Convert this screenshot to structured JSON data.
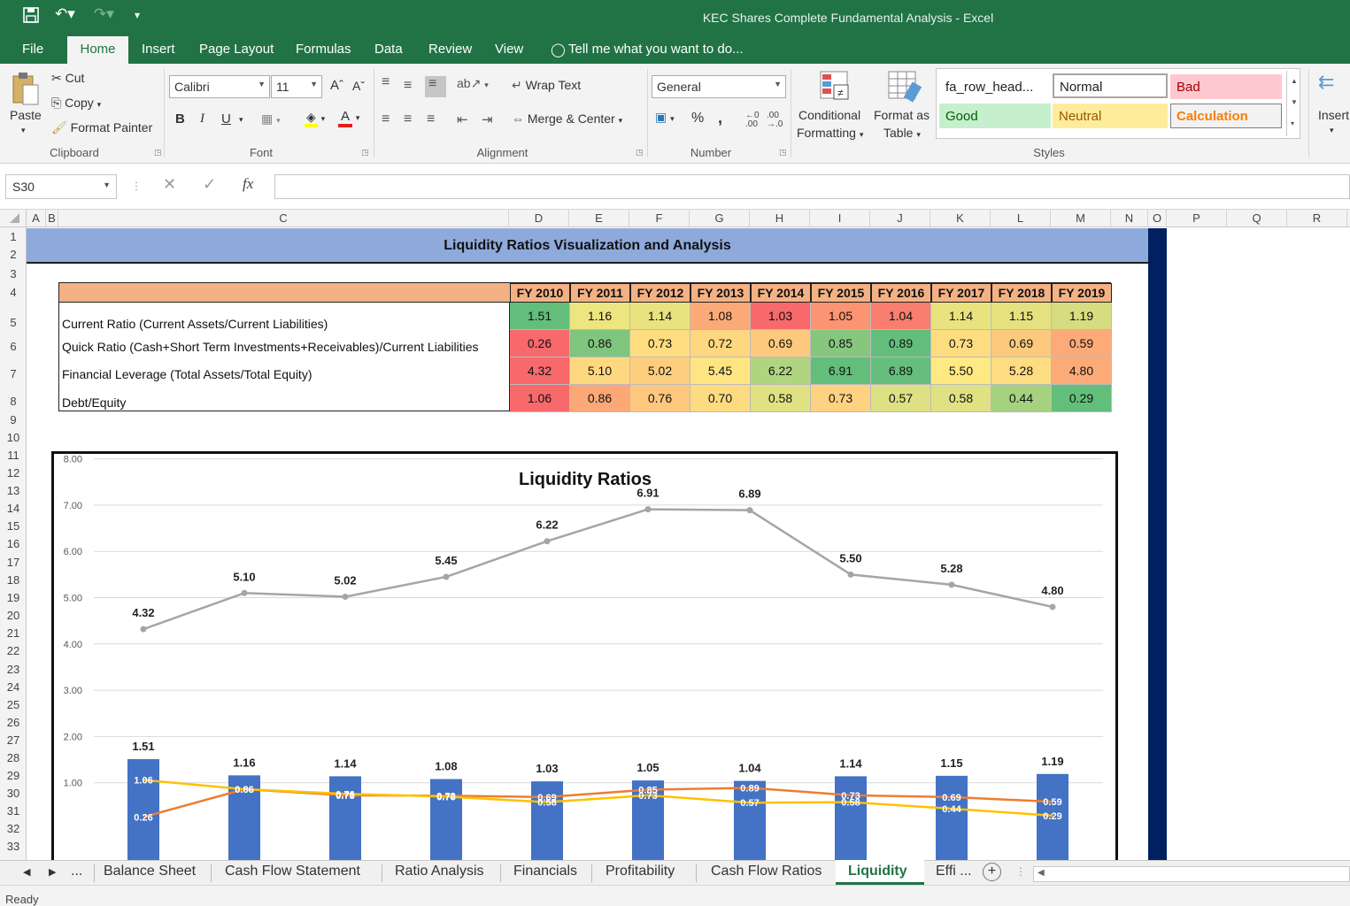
{
  "window": {
    "title": "KEC Shares Complete Fundamental Analysis - Excel"
  },
  "ribbon_tabs": [
    "File",
    "Home",
    "Insert",
    "Page Layout",
    "Formulas",
    "Data",
    "Review",
    "View"
  ],
  "tell_me": "Tell me what you want to do...",
  "clipboard": {
    "paste": "Paste",
    "cut": "Cut",
    "copy": "Copy",
    "format_painter": "Format Painter",
    "group": "Clipboard"
  },
  "font": {
    "name": "Calibri",
    "size": "11",
    "group": "Font",
    "bold": "B",
    "italic": "I",
    "underline": "U"
  },
  "alignment": {
    "wrap": "Wrap Text",
    "merge": "Merge & Center",
    "group": "Alignment"
  },
  "number": {
    "format": "General",
    "group": "Number",
    "percent": "%",
    "comma": ","
  },
  "styles": {
    "conditional": "Conditional",
    "formatting": "Formatting",
    "format_as": "Format as",
    "table": "Table",
    "group": "Styles",
    "fa_row": "fa_row_head...",
    "normal": "Normal",
    "bad": "Bad",
    "good": "Good",
    "neutral": "Neutral",
    "calculation": "Calculation"
  },
  "cells": {
    "insert": "Insert"
  },
  "formula_bar": {
    "name_box": "S30",
    "fx": "fx"
  },
  "columns": [
    "A",
    "B",
    "C",
    "D",
    "E",
    "F",
    "G",
    "H",
    "I",
    "J",
    "K",
    "L",
    "M",
    "N",
    "O",
    "P",
    "Q",
    "R"
  ],
  "rows": [
    "1",
    "2",
    "3",
    "4",
    "5",
    "6",
    "7",
    "8",
    "9",
    "10",
    "11",
    "12",
    "13",
    "14",
    "15",
    "16",
    "17",
    "18",
    "19",
    "20",
    "21",
    "22",
    "23",
    "24",
    "25",
    "26",
    "27",
    "28",
    "29",
    "30",
    "31",
    "32",
    "33",
    "34"
  ],
  "sheet": {
    "banner": "Liquidity Ratios Visualization and Analysis",
    "years": [
      "FY 2010",
      "FY 2011",
      "FY 2012",
      "FY 2013",
      "FY 2014",
      "FY 2015",
      "FY 2016",
      "FY 2017",
      "FY 2018",
      "FY 2019"
    ],
    "metrics": [
      {
        "label": "Current Ratio (Current Assets/Current Liabilities)",
        "values": [
          "1.51",
          "1.16",
          "1.14",
          "1.08",
          "1.03",
          "1.05",
          "1.04",
          "1.14",
          "1.15",
          "1.19"
        ],
        "colors": [
          "#63be7b",
          "#ede57f",
          "#e9e37f",
          "#fbaa77",
          "#f8696b",
          "#fa9473",
          "#f97e6f",
          "#e9e37f",
          "#e5e17f",
          "#d8dc80"
        ]
      },
      {
        "label": "Quick Ratio (Cash+Short Term Investments+Receivables)/Current Liabilities",
        "values": [
          "0.26",
          "0.86",
          "0.73",
          "0.72",
          "0.69",
          "0.85",
          "0.89",
          "0.73",
          "0.69",
          "0.59"
        ],
        "colors": [
          "#f8696b",
          "#7fc57d",
          "#fedd81",
          "#fed880",
          "#fdc97d",
          "#86c77d",
          "#63be7b",
          "#fedd81",
          "#fdc97d",
          "#fcaa78"
        ]
      },
      {
        "label": "Financial Leverage (Total Assets/Total Equity)",
        "values": [
          "4.32",
          "5.10",
          "5.02",
          "5.45",
          "6.22",
          "6.91",
          "6.89",
          "5.50",
          "5.28",
          "4.80"
        ],
        "colors": [
          "#f8696b",
          "#fed880",
          "#fece7f",
          "#fee582",
          "#b0d580",
          "#63be7b",
          "#65be7b",
          "#fee983",
          "#fedc81",
          "#fcab78"
        ]
      },
      {
        "label": "Debt/Equity",
        "values": [
          "1.06",
          "0.86",
          "0.76",
          "0.70",
          "0.58",
          "0.73",
          "0.57",
          "0.58",
          "0.44",
          "0.29"
        ],
        "colors": [
          "#f8696b",
          "#fba776",
          "#fdc77d",
          "#fedb81",
          "#e0e182",
          "#fed280",
          "#dde083",
          "#e0e182",
          "#a5d27f",
          "#63be7b"
        ]
      }
    ]
  },
  "chart_data": {
    "type": "bar",
    "title": "Liquidity Ratios",
    "categories": [
      "FY 2010",
      "FY 2011",
      "FY 2012",
      "FY 2013",
      "FY 2014",
      "FY 2015",
      "FY 2016",
      "FY 2017",
      "FY 2018",
      "FY 2019"
    ],
    "ylim": [
      0,
      8
    ],
    "yticks": [
      "8.00",
      "7.00",
      "6.00",
      "5.00",
      "4.00",
      "3.00",
      "2.00",
      "1.00"
    ],
    "grid": true,
    "series": [
      {
        "type": "bar",
        "values": [
          1.51,
          1.16,
          1.14,
          1.08,
          1.03,
          1.05,
          1.04,
          1.14,
          1.15,
          1.19
        ],
        "labels": [
          "1.51",
          "1.16",
          "1.14",
          "1.08",
          "1.03",
          "1.05",
          "1.04",
          "1.14",
          "1.15",
          "1.19"
        ],
        "color": "#4472c4"
      },
      {
        "type": "line",
        "values": [
          0.26,
          0.86,
          0.73,
          0.72,
          0.69,
          0.85,
          0.89,
          0.73,
          0.69,
          0.59
        ],
        "labels": [
          "0.26",
          "0.86",
          "0.73",
          "0.72",
          "0.69",
          "0.85",
          "0.89",
          "0.73",
          "0.69",
          "0.59"
        ],
        "color": "#ed7d31"
      },
      {
        "type": "line",
        "values": [
          4.32,
          5.1,
          5.02,
          5.45,
          6.22,
          6.91,
          6.89,
          5.5,
          5.28,
          4.8
        ],
        "labels": [
          "4.32",
          "5.10",
          "5.02",
          "5.45",
          "6.22",
          "6.91",
          "6.89",
          "5.50",
          "5.28",
          "4.80"
        ],
        "color": "#a5a5a5"
      },
      {
        "type": "line",
        "values": [
          1.06,
          0.86,
          0.76,
          0.7,
          0.58,
          0.73,
          0.57,
          0.58,
          0.44,
          0.29
        ],
        "labels": [
          "1.06",
          "0.86",
          "0.76",
          "0.70",
          "0.58",
          "0.73",
          "0.57",
          "0.58",
          "0.44",
          "0.29"
        ],
        "color": "#ffc000"
      }
    ]
  },
  "sheet_tabs": [
    "...",
    "Balance Sheet",
    "Cash Flow Statement",
    "Ratio Analysis",
    "Financials",
    "Profitability",
    "Cash Flow Ratios",
    "Liquidity",
    "Effi ..."
  ],
  "active_sheet": "Liquidity",
  "status": "Ready"
}
